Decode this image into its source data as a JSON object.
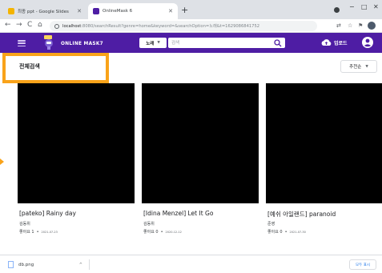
{
  "browser": {
    "tabs": [
      {
        "title": "최종 ppt - Google Slides",
        "favicon_color": "#f4b400",
        "active": false
      },
      {
        "title": "OnlineMask 6",
        "favicon_color": "#4e1da4",
        "active": true
      }
    ],
    "new_tab_icon": "plus-icon",
    "address": {
      "host": "localhost",
      "rest": ":8080/searchResult?genre=home&keyword=&searchOption=노래&t=1629086841752"
    }
  },
  "header": {
    "logo_text": "ONLINE MASK7",
    "search": {
      "option": "노래",
      "placeholder": "검색",
      "value": ""
    },
    "upload_label": "업로드",
    "brand_color": "#4e1da4"
  },
  "main": {
    "section_title": "전체검색",
    "sort_label": "추천순",
    "highlight_color": "#f9a31a",
    "videos": [
      {
        "title": "[pateko] Rainy day",
        "artist": "김동위",
        "likes_label": "좋아요 1",
        "date": "2021-07-23"
      },
      {
        "title": "[Idina Menzel] Let It Go",
        "artist": "김동위",
        "likes_label": "좋아요 0",
        "date": "2020-12-12"
      },
      {
        "title": "[예쉬 아일랜드] paranoid",
        "artist": "준영",
        "likes_label": "좋아요 0",
        "date": "2021-07-30"
      }
    ]
  },
  "downloads": {
    "file_name": "db.png",
    "show_all_label": "모두 표시"
  }
}
